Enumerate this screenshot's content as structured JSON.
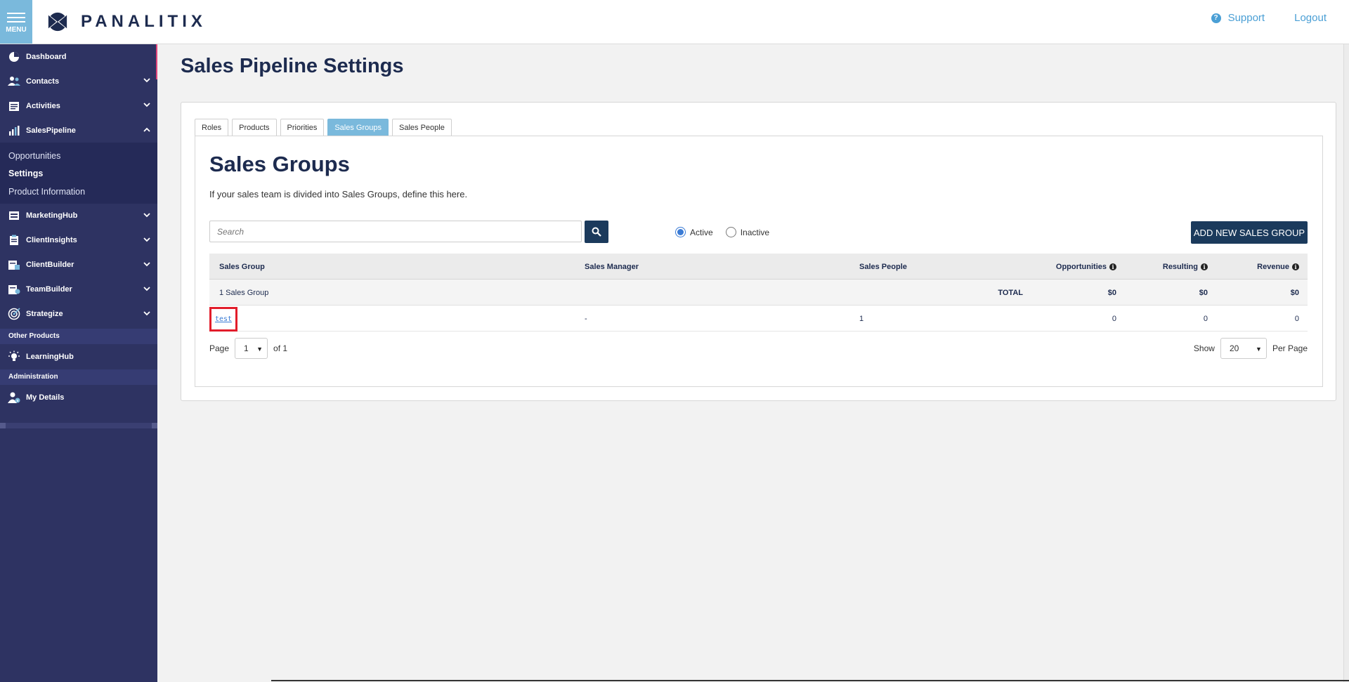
{
  "header": {
    "menu_label": "MENU",
    "logo_text": "PANALITIX",
    "support_label": "Support",
    "logout_label": "Logout"
  },
  "sidebar": {
    "items": [
      {
        "label": "Dashboard"
      },
      {
        "label": "Contacts"
      },
      {
        "label": "Activities"
      },
      {
        "label": "SalesPipeline"
      }
    ],
    "sales_pipeline_sub": [
      {
        "label": "Opportunities"
      },
      {
        "label": "Settings"
      },
      {
        "label": "Product Information"
      }
    ],
    "items2": [
      {
        "label": "MarketingHub"
      },
      {
        "label": "ClientInsights"
      },
      {
        "label": "ClientBuilder"
      },
      {
        "label": "TeamBuilder"
      },
      {
        "label": "Strategize"
      }
    ],
    "other_products_label": "Other Products",
    "learninghub_label": "LearningHub",
    "administration_label": "Administration",
    "my_details_label": "My Details"
  },
  "main": {
    "page_title": "Sales Pipeline Settings",
    "tabs": [
      {
        "label": "Roles"
      },
      {
        "label": "Products"
      },
      {
        "label": "Priorities"
      },
      {
        "label": "Sales Groups"
      },
      {
        "label": "Sales People"
      }
    ],
    "section_title": "Sales Groups",
    "section_description": "If your sales team is divided into Sales Groups, define this here.",
    "search_placeholder": "Search",
    "filter": {
      "active_label": "Active",
      "inactive_label": "Inactive"
    },
    "add_button_label": "ADD NEW SALES GROUP",
    "table": {
      "headers": {
        "sales_group": "Sales Group",
        "sales_manager": "Sales Manager",
        "sales_people": "Sales People",
        "opportunities": "Opportunities",
        "resulting": "Resulting",
        "revenue": "Revenue"
      },
      "total_row": {
        "count_label": "1 Sales Group",
        "total_label": "TOTAL",
        "opportunities": "$0",
        "resulting": "$0",
        "revenue": "$0"
      },
      "rows": [
        {
          "sales_group": "test",
          "sales_manager": "-",
          "sales_people": "1",
          "opportunities": "0",
          "resulting": "0",
          "revenue": "0"
        }
      ]
    },
    "pager": {
      "page_label": "Page",
      "page_value": "1",
      "of_label": "of 1",
      "show_label": "Show",
      "per_page_value": "20",
      "per_page_label": "Per Page"
    }
  },
  "colors": {
    "sidebar_bg": "#2e3362",
    "accent_blue": "#7ab9dc",
    "primary_button": "#1b3a5c",
    "link": "#3a7bd5",
    "highlight_box": "#e21d2b"
  }
}
